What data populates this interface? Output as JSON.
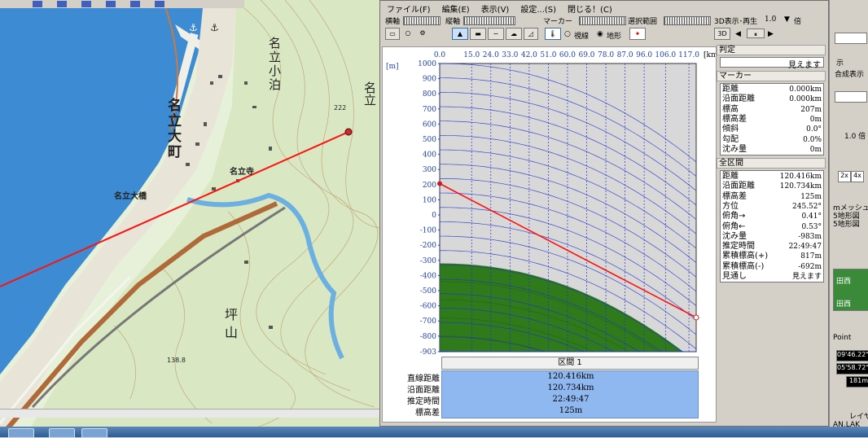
{
  "menu": [
    "ファイル(F)",
    "編集(E)",
    "表示(V)",
    "設定...(S)",
    "閉じる！(C)"
  ],
  "toolbar": {
    "horizontal_label": "横軸",
    "vertical_label": "縦軸",
    "marker_label": "マーカー",
    "selection_label": "選択範囲",
    "view3d_label": "3D表示･再生",
    "speed_value": "1.0",
    "speed_unit": "倍",
    "radio_line": "視線",
    "radio_terrain": "地形"
  },
  "chart_data": {
    "type": "area",
    "x_unit": "[km]",
    "y_unit": "[m]",
    "x_ticks": [
      "0.0",
      "15.0",
      "24.0",
      "33.0",
      "42.0",
      "51.0",
      "60.0",
      "69.0",
      "78.0",
      "87.0",
      "96.0",
      "106.0",
      "117.0"
    ],
    "y_ticks": [
      1000,
      900,
      800,
      700,
      600,
      500,
      400,
      300,
      200,
      100,
      0,
      -100,
      -200,
      -300,
      -400,
      -500,
      -600,
      -700,
      -800,
      -903
    ],
    "ylim": [
      -903,
      1000
    ],
    "xlim": [
      0,
      120.416
    ],
    "line_of_sight": {
      "start": [
        0,
        207
      ],
      "end": [
        120.416,
        -677
      ]
    },
    "earth_bulge_peak": -320
  },
  "section_label": "区間 1",
  "stats": [
    {
      "label": "直線距離",
      "value": "120.416km"
    },
    {
      "label": "沿面距離",
      "value": "120.734km"
    },
    {
      "label": "推定時間",
      "value": "22:49:47"
    },
    {
      "label": "標高差",
      "value": "125m"
    }
  ],
  "judgement": {
    "title": "判定",
    "value": "見えます"
  },
  "marker": {
    "title": "マーカー",
    "rows": [
      {
        "k": "距離",
        "v": "0.000km"
      },
      {
        "k": "沿面距離",
        "v": "0.000km"
      },
      {
        "k": "標高",
        "v": "207m"
      },
      {
        "k": "標高差",
        "v": "0m"
      },
      {
        "k": "傾斜",
        "v": "0.0°"
      },
      {
        "k": "勾配",
        "v": "0.0%"
      },
      {
        "k": "沈み量",
        "v": "0m"
      }
    ]
  },
  "all_section": {
    "title": "全区間",
    "rows": [
      {
        "k": "距離",
        "v": "120.416km"
      },
      {
        "k": "沿面距離",
        "v": "120.734km"
      },
      {
        "k": "標高差",
        "v": "125m"
      },
      {
        "k": "方位",
        "v": "245.52°"
      },
      {
        "k": "俯角→",
        "v": "0.41°"
      },
      {
        "k": "俯角←",
        "v": "0.53°"
      },
      {
        "k": "沈み量",
        "v": "-983m"
      },
      {
        "k": "推定時間",
        "v": "22:49:47"
      },
      {
        "k": "累積標高(+)",
        "v": "817m"
      },
      {
        "k": "累積標高(-)",
        "v": "-692m"
      },
      {
        "k": "見通し",
        "v": "見えます"
      }
    ]
  },
  "map_labels": {
    "town": "名立大町",
    "komari": "名立小泊",
    "bridge": "名立大橋",
    "temple": "名立寺",
    "mountain": "坪山",
    "alt1": "222",
    "alt2": "138.8",
    "coast": "名立"
  },
  "right_panel": {
    "t1": "示",
    "t2": "合成表示",
    "speed": "1.0 倍",
    "zoom2": "2x",
    "zoom4": "4x",
    "mesh": "mメッシュ",
    "map1": "5地形図",
    "map2": "5地形図",
    "point": "Point",
    "coord1": "09'46.22\"",
    "coord2": "05'58.72\"",
    "alt": "181m",
    "layer": "レイヤー",
    "file": "AN.LAK",
    "place1": "田西",
    "place2": "田西"
  }
}
